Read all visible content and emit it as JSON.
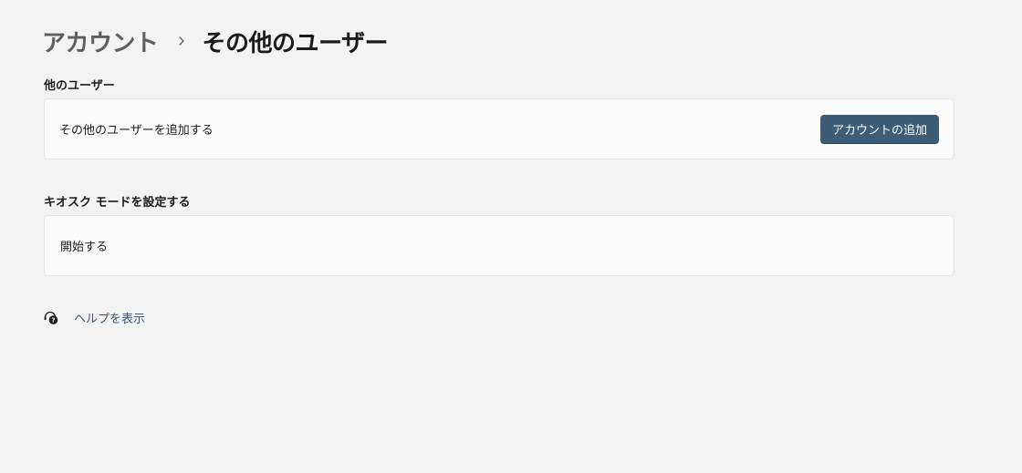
{
  "breadcrumb": {
    "parent": "アカウント",
    "separator_icon": "chevron-right-icon",
    "current": "その他のユーザー"
  },
  "other_users": {
    "section_title": "他のユーザー",
    "add_label": "その他のユーザーを追加する",
    "add_button": "アカウントの追加"
  },
  "kiosk": {
    "section_title": "キオスク モードを設定する",
    "start_label": "開始する"
  },
  "help": {
    "icon": "help-headset-icon",
    "label": "ヘルプを表示"
  },
  "colors": {
    "background": "#f3f3f3",
    "card": "#fbfbfb",
    "accent_button": "#3d5c76",
    "link": "#3a5572"
  }
}
